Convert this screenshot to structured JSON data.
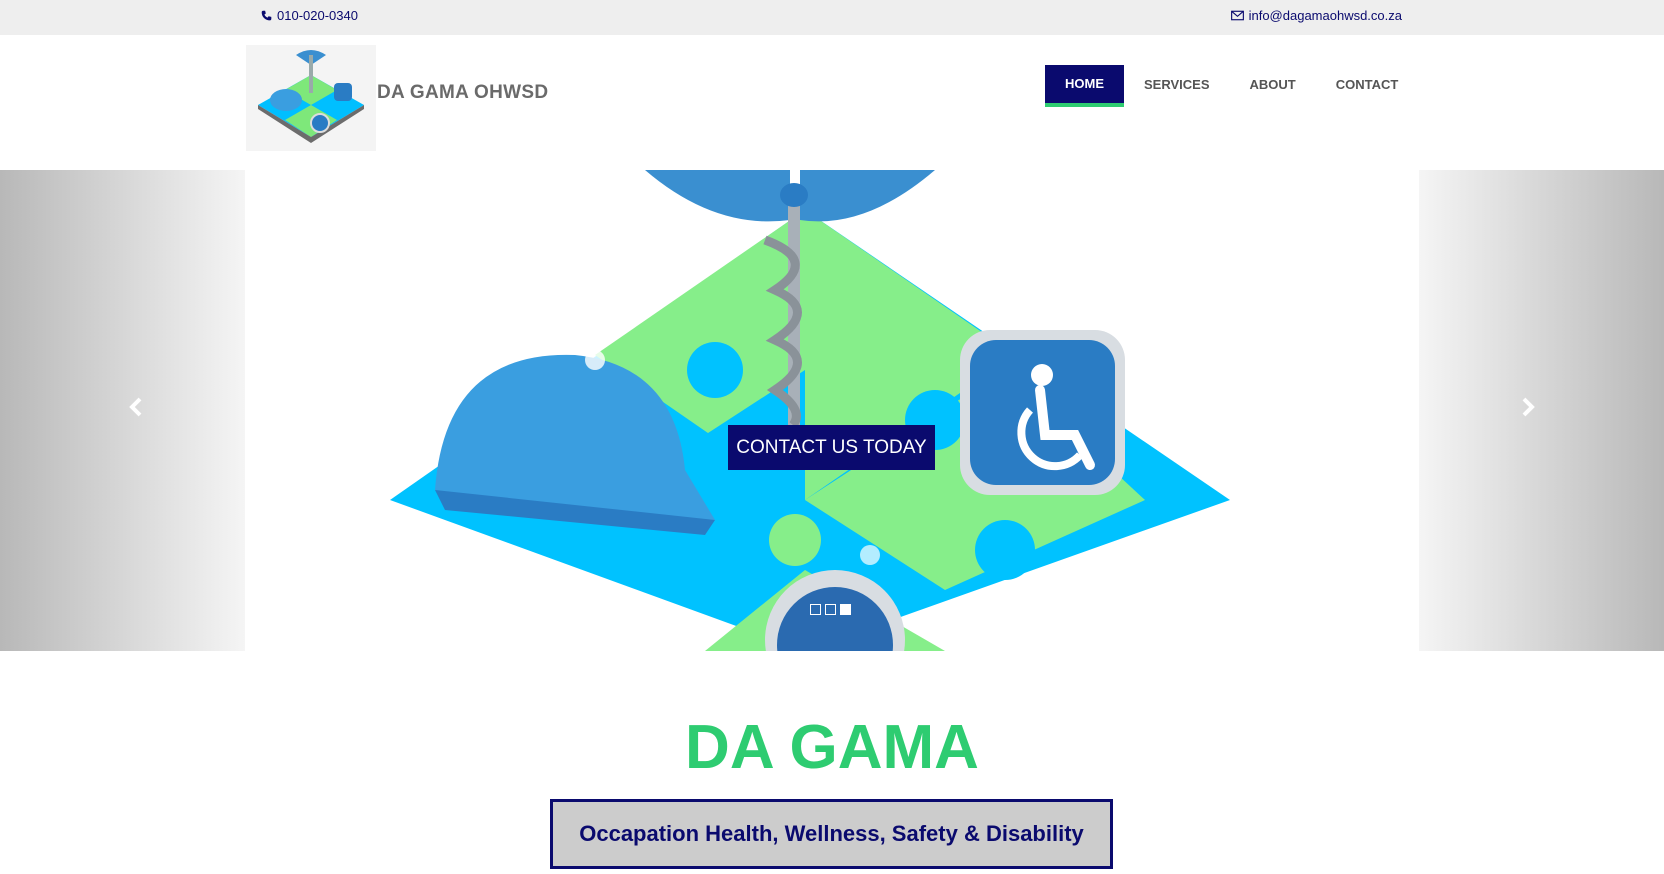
{
  "topbar": {
    "phone": "010-020-0340",
    "email": "info@dagamaohwsd.co.za",
    "phone_icon": "phone-icon",
    "email_icon": "envelope-icon"
  },
  "header": {
    "brand": "DA GAMA OHWSD",
    "logo_icon": "logo-puzzle-icon"
  },
  "nav": {
    "items": [
      {
        "label": "HOME",
        "active": true
      },
      {
        "label": "SERVICES",
        "active": false
      },
      {
        "label": "ABOUT",
        "active": false
      },
      {
        "label": "CONTACT",
        "active": false
      }
    ]
  },
  "carousel": {
    "cta_label": "CONTACT US TODAY",
    "prev_icon": "chevron-left-icon",
    "next_icon": "chevron-right-icon",
    "slides": 3,
    "active_slide": 3
  },
  "intro": {
    "title": "DA GAMA",
    "tagline": "Occapation Health, Wellness, Safety & Disability"
  },
  "colors": {
    "brand_navy": "#0a0a6e",
    "accent_green": "#2ecc71",
    "topbar_bg": "#eeeeee"
  }
}
